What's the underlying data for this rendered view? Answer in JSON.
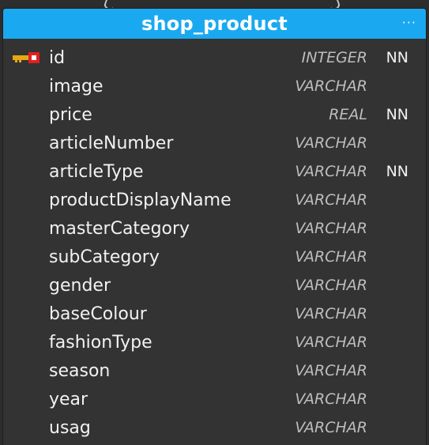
{
  "table": {
    "title": "shop_product",
    "menu_glyph": "···",
    "columns": [
      {
        "name": "id",
        "type": "INTEGER",
        "flag": "NN",
        "primary_key": true
      },
      {
        "name": "image",
        "type": "VARCHAR",
        "flag": ""
      },
      {
        "name": "price",
        "type": "REAL",
        "flag": "NN"
      },
      {
        "name": "articleNumber",
        "type": "VARCHAR",
        "flag": ""
      },
      {
        "name": "articleType",
        "type": "VARCHAR",
        "flag": "NN"
      },
      {
        "name": "productDisplayName",
        "type": "VARCHAR",
        "flag": ""
      },
      {
        "name": "masterCategory",
        "type": "VARCHAR",
        "flag": ""
      },
      {
        "name": "subCategory",
        "type": "VARCHAR",
        "flag": ""
      },
      {
        "name": "gender",
        "type": "VARCHAR",
        "flag": ""
      },
      {
        "name": "baseColour",
        "type": "VARCHAR",
        "flag": ""
      },
      {
        "name": "fashionType",
        "type": "VARCHAR",
        "flag": ""
      },
      {
        "name": "season",
        "type": "VARCHAR",
        "flag": ""
      },
      {
        "name": "year",
        "type": "VARCHAR",
        "flag": ""
      },
      {
        "name": "usag",
        "type": "VARCHAR",
        "flag": ""
      }
    ]
  },
  "colors": {
    "header": "#1aa9f0",
    "body": "#333333",
    "key_gold": "#e6a817",
    "key_red": "#e02020"
  },
  "icons": {
    "primary_key": "key-icon",
    "menu": "more-icon"
  }
}
